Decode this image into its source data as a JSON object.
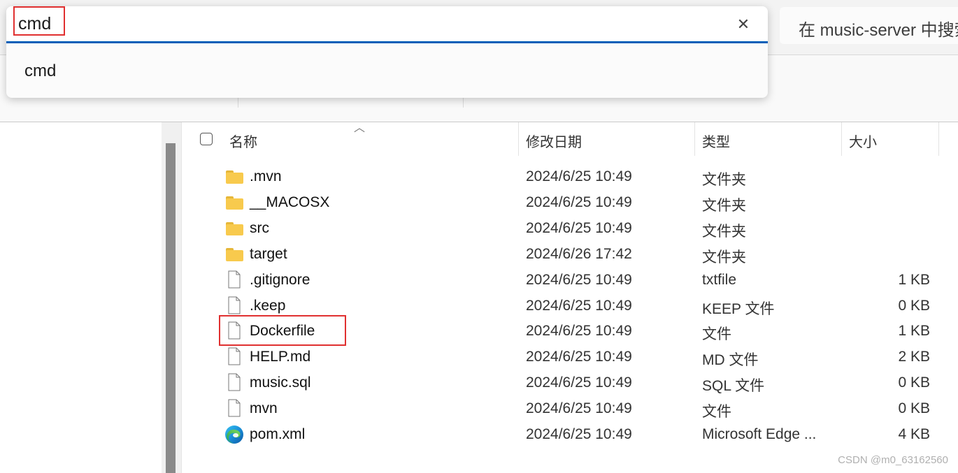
{
  "address_bar": {
    "value": "cmd",
    "clear_label": "✕",
    "suggestions": [
      "cmd"
    ]
  },
  "search": {
    "placeholder": "在 music-server 中搜索"
  },
  "columns": {
    "name": "名称",
    "modified": "修改日期",
    "type": "类型",
    "size": "大小"
  },
  "files": [
    {
      "name": ".mvn",
      "modified": "2024/6/25 10:49",
      "type": "文件夹",
      "size": "",
      "icon": "folder-icon"
    },
    {
      "name": "__MACOSX",
      "modified": "2024/6/25 10:49",
      "type": "文件夹",
      "size": "",
      "icon": "folder-icon"
    },
    {
      "name": "src",
      "modified": "2024/6/25 10:49",
      "type": "文件夹",
      "size": "",
      "icon": "folder-icon"
    },
    {
      "name": "target",
      "modified": "2024/6/26 17:42",
      "type": "文件夹",
      "size": "",
      "icon": "folder-icon"
    },
    {
      "name": ".gitignore",
      "modified": "2024/6/25 10:49",
      "type": "txtfile",
      "size": "1 KB",
      "icon": "file-icon"
    },
    {
      "name": ".keep",
      "modified": "2024/6/25 10:49",
      "type": "KEEP 文件",
      "size": "0 KB",
      "icon": "file-icon"
    },
    {
      "name": "Dockerfile",
      "modified": "2024/6/25 10:49",
      "type": "文件",
      "size": "1 KB",
      "icon": "file-icon"
    },
    {
      "name": "HELP.md",
      "modified": "2024/6/25 10:49",
      "type": "MD 文件",
      "size": "2 KB",
      "icon": "file-icon"
    },
    {
      "name": "music.sql",
      "modified": "2024/6/25 10:49",
      "type": "SQL 文件",
      "size": "0 KB",
      "icon": "file-icon"
    },
    {
      "name": "mvn",
      "modified": "2024/6/25 10:49",
      "type": "文件",
      "size": "0 KB",
      "icon": "file-icon"
    },
    {
      "name": "pom.xml",
      "modified": "2024/6/25 10:49",
      "type": "Microsoft Edge ...",
      "size": "4 KB",
      "icon": "edge-icon"
    }
  ],
  "watermark": "CSDN @m0_63162560",
  "colors": {
    "accent": "#005fb8",
    "highlight": "#e03030",
    "folder": "#f8ca4d"
  }
}
